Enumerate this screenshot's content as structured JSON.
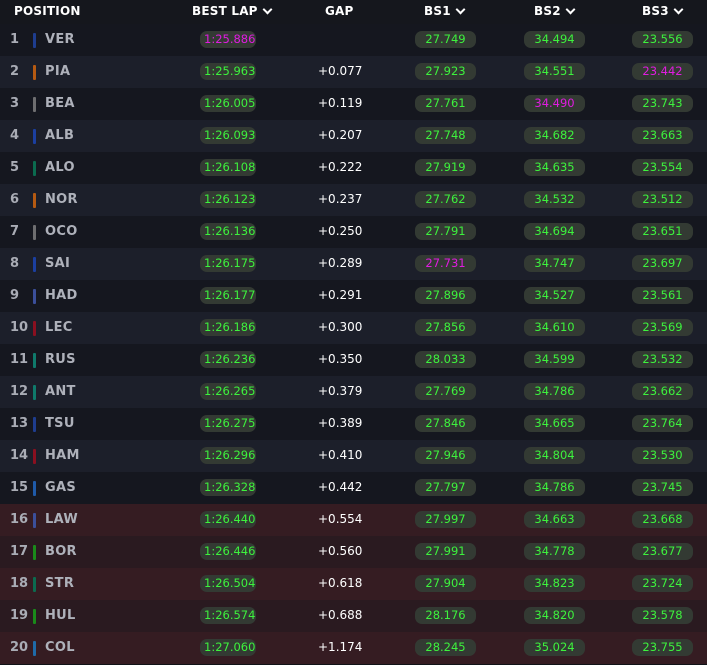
{
  "header": {
    "position": "POSITION",
    "best_lap": "BEST LAP",
    "gap": "GAP",
    "bs1": "BS1",
    "bs2": "BS2",
    "bs3": "BS3"
  },
  "colors": {
    "green": "#3df23d",
    "purple": "#e01ce0",
    "eliminated_row": "#351c22"
  },
  "rows": [
    {
      "pos": "1",
      "driver": "VER",
      "team_color": "#1e3d8f",
      "lap": "1:25.886",
      "lap_c": "purple",
      "gap": "",
      "bs1": "27.749",
      "bs1_c": "green",
      "bs2": "34.494",
      "bs2_c": "green",
      "bs3": "23.556",
      "bs3_c": "green",
      "elim": false
    },
    {
      "pos": "2",
      "driver": "PIA",
      "team_color": "#b55a12",
      "lap": "1:25.963",
      "lap_c": "green",
      "gap": "+0.077",
      "bs1": "27.923",
      "bs1_c": "green",
      "bs2": "34.551",
      "bs2_c": "green",
      "bs3": "23.442",
      "bs3_c": "purple",
      "elim": false
    },
    {
      "pos": "3",
      "driver": "BEA",
      "team_color": "#6e6e70",
      "lap": "1:26.005",
      "lap_c": "green",
      "gap": "+0.119",
      "bs1": "27.761",
      "bs1_c": "green",
      "bs2": "34.490",
      "bs2_c": "purple",
      "bs3": "23.743",
      "bs3_c": "green",
      "elim": false
    },
    {
      "pos": "4",
      "driver": "ALB",
      "team_color": "#1b3fa0",
      "lap": "1:26.093",
      "lap_c": "green",
      "gap": "+0.207",
      "bs1": "27.748",
      "bs1_c": "green",
      "bs2": "34.682",
      "bs2_c": "green",
      "bs3": "23.663",
      "bs3_c": "green",
      "elim": false
    },
    {
      "pos": "5",
      "driver": "ALO",
      "team_color": "#0b6b4f",
      "lap": "1:26.108",
      "lap_c": "green",
      "gap": "+0.222",
      "bs1": "27.919",
      "bs1_c": "green",
      "bs2": "34.635",
      "bs2_c": "green",
      "bs3": "23.554",
      "bs3_c": "green",
      "elim": false
    },
    {
      "pos": "6",
      "driver": "NOR",
      "team_color": "#b55a12",
      "lap": "1:26.123",
      "lap_c": "green",
      "gap": "+0.237",
      "bs1": "27.762",
      "bs1_c": "green",
      "bs2": "34.532",
      "bs2_c": "green",
      "bs3": "23.512",
      "bs3_c": "green",
      "elim": false
    },
    {
      "pos": "7",
      "driver": "OCO",
      "team_color": "#6e6e70",
      "lap": "1:26.136",
      "lap_c": "green",
      "gap": "+0.250",
      "bs1": "27.791",
      "bs1_c": "green",
      "bs2": "34.694",
      "bs2_c": "green",
      "bs3": "23.651",
      "bs3_c": "green",
      "elim": false
    },
    {
      "pos": "8",
      "driver": "SAI",
      "team_color": "#1b3fa0",
      "lap": "1:26.175",
      "lap_c": "green",
      "gap": "+0.289",
      "bs1": "27.731",
      "bs1_c": "purple",
      "bs2": "34.747",
      "bs2_c": "green",
      "bs3": "23.697",
      "bs3_c": "green",
      "elim": false
    },
    {
      "pos": "9",
      "driver": "HAD",
      "team_color": "#3b4f9a",
      "lap": "1:26.177",
      "lap_c": "green",
      "gap": "+0.291",
      "bs1": "27.896",
      "bs1_c": "green",
      "bs2": "34.527",
      "bs2_c": "green",
      "bs3": "23.561",
      "bs3_c": "green",
      "elim": false
    },
    {
      "pos": "10",
      "driver": "LEC",
      "team_color": "#8a1020",
      "lap": "1:26.186",
      "lap_c": "green",
      "gap": "+0.300",
      "bs1": "27.856",
      "bs1_c": "green",
      "bs2": "34.610",
      "bs2_c": "green",
      "bs3": "23.569",
      "bs3_c": "green",
      "elim": false
    },
    {
      "pos": "11",
      "driver": "RUS",
      "team_color": "#0f7a6b",
      "lap": "1:26.236",
      "lap_c": "green",
      "gap": "+0.350",
      "bs1": "28.033",
      "bs1_c": "green",
      "bs2": "34.599",
      "bs2_c": "green",
      "bs3": "23.532",
      "bs3_c": "green",
      "elim": false
    },
    {
      "pos": "12",
      "driver": "ANT",
      "team_color": "#0f7a6b",
      "lap": "1:26.265",
      "lap_c": "green",
      "gap": "+0.379",
      "bs1": "27.769",
      "bs1_c": "green",
      "bs2": "34.786",
      "bs2_c": "green",
      "bs3": "23.662",
      "bs3_c": "green",
      "elim": false
    },
    {
      "pos": "13",
      "driver": "TSU",
      "team_color": "#1e3d8f",
      "lap": "1:26.275",
      "lap_c": "green",
      "gap": "+0.389",
      "bs1": "27.846",
      "bs1_c": "green",
      "bs2": "34.665",
      "bs2_c": "green",
      "bs3": "23.764",
      "bs3_c": "green",
      "elim": false
    },
    {
      "pos": "14",
      "driver": "HAM",
      "team_color": "#8a1020",
      "lap": "1:26.296",
      "lap_c": "green",
      "gap": "+0.410",
      "bs1": "27.946",
      "bs1_c": "green",
      "bs2": "34.804",
      "bs2_c": "green",
      "bs3": "23.530",
      "bs3_c": "green",
      "elim": false
    },
    {
      "pos": "15",
      "driver": "GAS",
      "team_color": "#1f5aa8",
      "lap": "1:26.328",
      "lap_c": "green",
      "gap": "+0.442",
      "bs1": "27.797",
      "bs1_c": "green",
      "bs2": "34.786",
      "bs2_c": "green",
      "bs3": "23.745",
      "bs3_c": "green",
      "elim": false
    },
    {
      "pos": "16",
      "driver": "LAW",
      "team_color": "#3b4f9a",
      "lap": "1:26.440",
      "lap_c": "green",
      "gap": "+0.554",
      "bs1": "27.997",
      "bs1_c": "green",
      "bs2": "34.663",
      "bs2_c": "green",
      "bs3": "23.668",
      "bs3_c": "green",
      "elim": true
    },
    {
      "pos": "17",
      "driver": "BOR",
      "team_color": "#1a8a1a",
      "lap": "1:26.446",
      "lap_c": "green",
      "gap": "+0.560",
      "bs1": "27.991",
      "bs1_c": "green",
      "bs2": "34.778",
      "bs2_c": "green",
      "bs3": "23.677",
      "bs3_c": "green",
      "elim": true
    },
    {
      "pos": "18",
      "driver": "STR",
      "team_color": "#0b6b4f",
      "lap": "1:26.504",
      "lap_c": "green",
      "gap": "+0.618",
      "bs1": "27.904",
      "bs1_c": "green",
      "bs2": "34.823",
      "bs2_c": "green",
      "bs3": "23.724",
      "bs3_c": "green",
      "elim": true
    },
    {
      "pos": "19",
      "driver": "HUL",
      "team_color": "#1a8a1a",
      "lap": "1:26.574",
      "lap_c": "green",
      "gap": "+0.688",
      "bs1": "28.176",
      "bs1_c": "green",
      "bs2": "34.820",
      "bs2_c": "green",
      "bs3": "23.578",
      "bs3_c": "green",
      "elim": true
    },
    {
      "pos": "20",
      "driver": "COL",
      "team_color": "#1f6aa8",
      "lap": "1:27.060",
      "lap_c": "green",
      "gap": "+1.174",
      "bs1": "28.245",
      "bs1_c": "green",
      "bs2": "35.024",
      "bs2_c": "green",
      "bs3": "23.755",
      "bs3_c": "green",
      "elim": true
    }
  ]
}
